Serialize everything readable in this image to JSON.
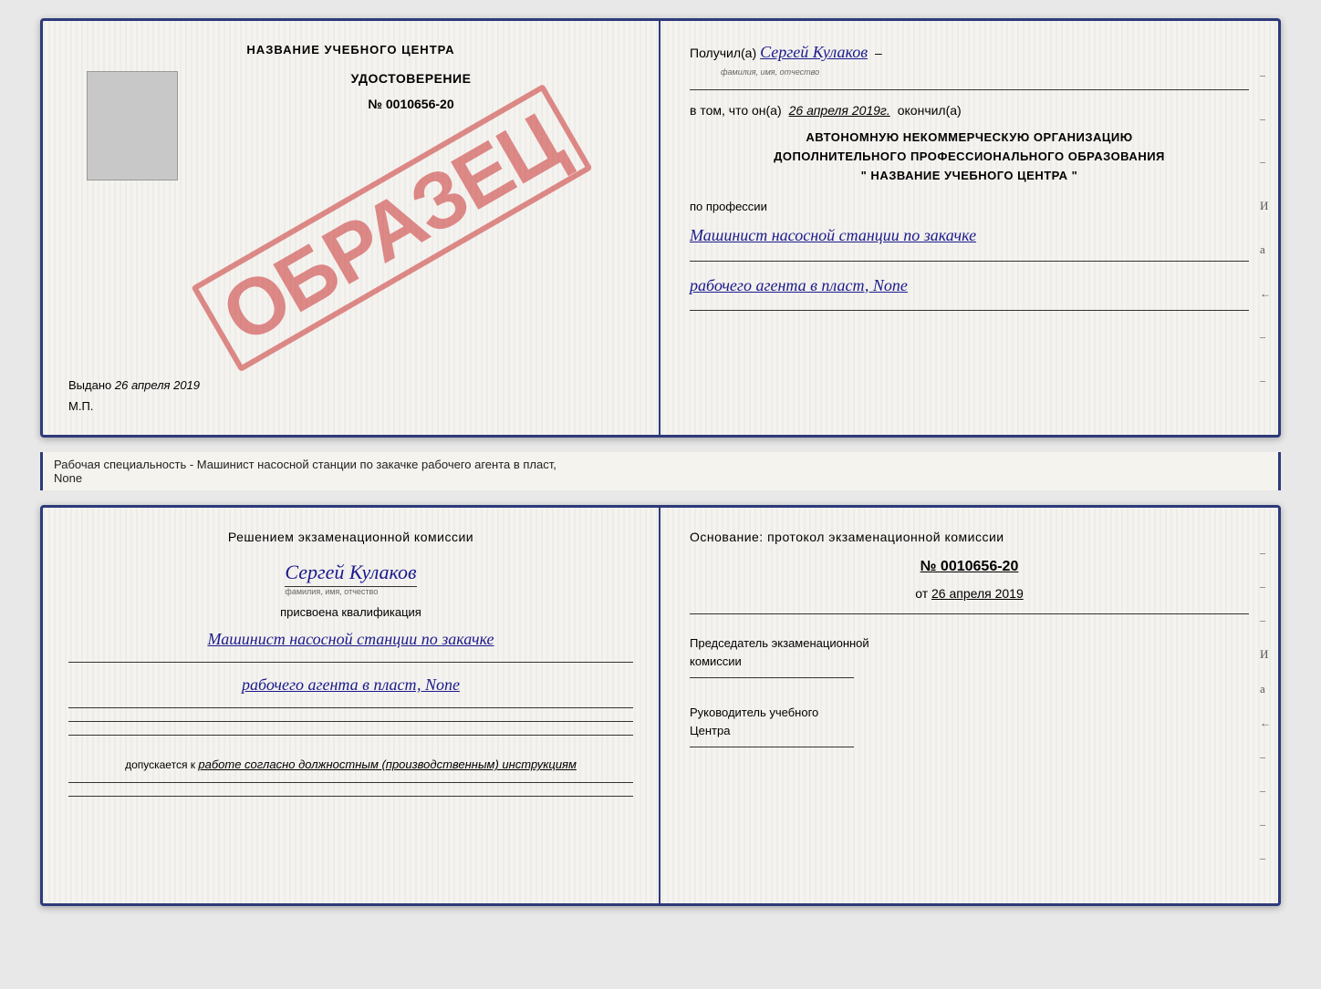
{
  "topDoc": {
    "left": {
      "schoolName": "НАЗВАНИЕ УЧЕБНОГО ЦЕНТРА",
      "stamp": "ОБРАЗЕЦ",
      "certTitle": "УДОСТОВЕРЕНИЕ",
      "certNumber": "№ 0010656-20",
      "issuedLabel": "Выдано",
      "issuedDate": "26 апреля 2019",
      "mpLabel": "М.П."
    },
    "right": {
      "receivedLabel": "Получил(а)",
      "recipientName": "Сергей Кулаков",
      "fioSubLabel": "фамилия, имя, отчество",
      "dashLabel": "–",
      "inThatLabel": "в том, что он(а)",
      "completedDate": "26 апреля 2019г.",
      "completedLabel": "окончил(а)",
      "orgLine1": "АВТОНОМНУЮ НЕКОММЕРЧЕСКУЮ ОРГАНИЗАЦИЮ",
      "orgLine2": "ДОПОЛНИТЕЛЬНОГО ПРОФЕССИОНАЛЬНОГО ОБРАЗОВАНИЯ",
      "orgLine3": "\"   НАЗВАНИЕ УЧЕБНОГО ЦЕНТРА   \"",
      "professionLabel": "по профессии",
      "professionLine1": "Машинист насосной станции по закачке",
      "professionLine2": "рабочего агента в пласт, None"
    }
  },
  "separator": {
    "text": "Рабочая специальность - Машинист насосной станции по закачке рабочего агента в пласт,",
    "text2": "None"
  },
  "bottomDoc": {
    "left": {
      "commissionTitle": "Решением экзаменационной комиссии",
      "personName": "Сергей Кулаков",
      "fioSubLabel": "фамилия, имя, отчество",
      "qualificationLabel": "присвоена квалификация",
      "qualificationLine1": "Машинист насосной станции по закачке",
      "qualificationLine2": "рабочего агента в пласт, None",
      "допускаетсяLabel": "допускается к",
      "допускаетсяValue": "работе согласно должностным (производственным) инструкциям"
    },
    "right": {
      "basisTitle": "Основание: протокол экзаменационной комиссии",
      "protocolNumber": "№ 0010656-20",
      "protocolDatePrefix": "от",
      "protocolDate": "26 апреля 2019",
      "chairmanLabel": "Председатель экзаменационной",
      "chairmanLabel2": "комиссии",
      "directorLabel": "Руководитель учебного",
      "directorLabel2": "Центра"
    },
    "rightMarks": [
      "-",
      "-",
      "-",
      "И",
      "а",
      "←",
      "-",
      "-",
      "-",
      "-"
    ]
  }
}
